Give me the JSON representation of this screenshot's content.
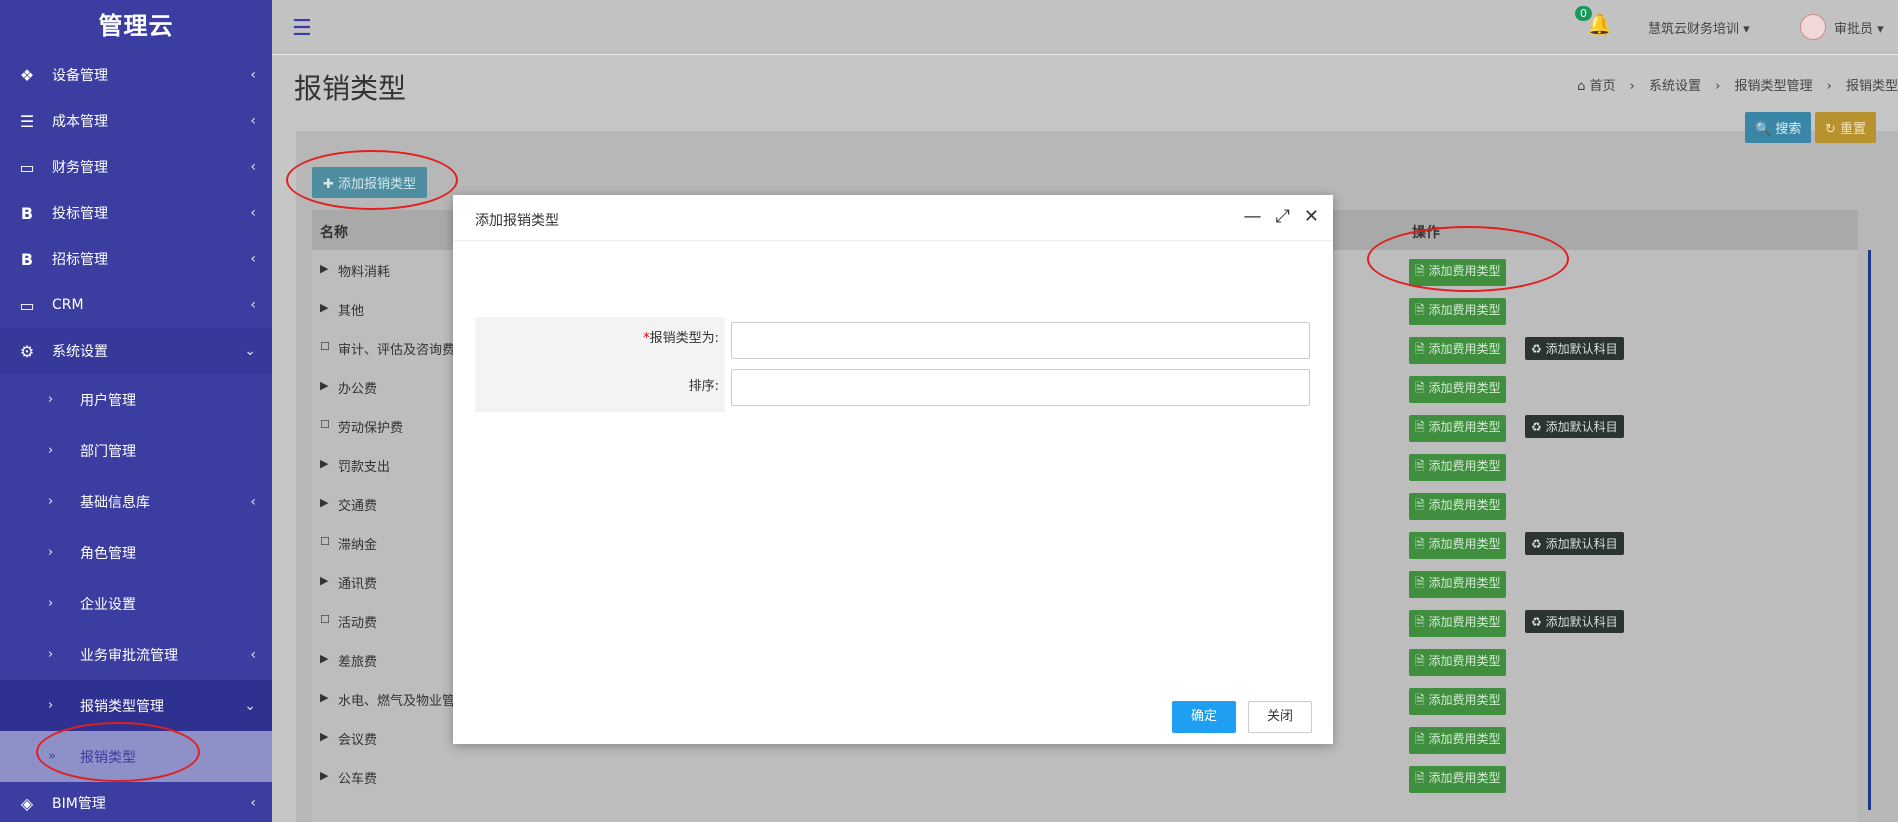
{
  "app": {
    "brand": "管理云"
  },
  "sidebar": {
    "items": [
      {
        "label": "设备管理",
        "icon": "cubes-icon",
        "glyph": "❖"
      },
      {
        "label": "成本管理",
        "icon": "list-icon",
        "glyph": "☰"
      },
      {
        "label": "财务管理",
        "icon": "desktop-icon",
        "glyph": "▭"
      },
      {
        "label": "投标管理",
        "icon": "bold-b-icon",
        "glyph": "B"
      },
      {
        "label": "招标管理",
        "icon": "bold-b-icon",
        "glyph": "B"
      },
      {
        "label": "CRM",
        "icon": "desktop-icon",
        "glyph": "▭"
      },
      {
        "label": "系统设置",
        "icon": "gear-icon",
        "glyph": "⚙"
      }
    ],
    "sub_items": [
      {
        "label": "用户管理"
      },
      {
        "label": "部门管理"
      },
      {
        "label": "基础信息库"
      },
      {
        "label": "角色管理"
      },
      {
        "label": "企业设置"
      },
      {
        "label": "业务审批流管理"
      },
      {
        "label": "报销类型管理"
      },
      {
        "label": "报销类型"
      }
    ],
    "bottom": {
      "label": "BIM管理",
      "icon": "cube-icon",
      "glyph": "◈"
    }
  },
  "topbar": {
    "notifications": "0",
    "org": "慧筑云财务培训 ▾",
    "user": "审批员 ▾"
  },
  "page": {
    "title": "报销类型",
    "breadcrumb": [
      "首页",
      "系统设置",
      "报销类型管理",
      "报销类型"
    ]
  },
  "toolbar": {
    "add": "✚ 添加报销类型",
    "search": "🔍 搜索",
    "reset": "↻ 重置"
  },
  "table": {
    "headers": {
      "name": "名称",
      "op": "操作"
    },
    "rows": [
      {
        "toggle": "▶",
        "name": "物料消耗",
        "default": ""
      },
      {
        "toggle": "▶",
        "name": "其他",
        "default": ""
      },
      {
        "toggle": "☐",
        "name": "审计、评估及咨询费",
        "default": "♻ 添加默认科目"
      },
      {
        "toggle": "▶",
        "name": "办公费",
        "default": ""
      },
      {
        "toggle": "☐",
        "name": "劳动保护费",
        "default": "♻ 添加默认科目"
      },
      {
        "toggle": "▶",
        "name": "罚款支出",
        "default": ""
      },
      {
        "toggle": "▶",
        "name": "交通费",
        "default": ""
      },
      {
        "toggle": "☐",
        "name": "滞纳金",
        "default": "♻ 添加默认科目"
      },
      {
        "toggle": "▶",
        "name": "通讯费",
        "default": ""
      },
      {
        "toggle": "☐",
        "name": "活动费",
        "default": "♻ 添加默认科目"
      },
      {
        "toggle": "▶",
        "name": "差旅费",
        "default": ""
      },
      {
        "toggle": "▶",
        "name": "水电、燃气及物业管",
        "default": ""
      },
      {
        "toggle": "▶",
        "name": "会议费",
        "default": ""
      },
      {
        "toggle": "▶",
        "name": "公车费",
        "default": ""
      }
    ],
    "add_fee_label": "🗎 添加费用类型"
  },
  "modal": {
    "title": "添加报销类型",
    "field_type_label": "报销类型为:",
    "field_type_required": "*",
    "field_type_value": "",
    "field_order_label": "排序:",
    "field_order_value": "",
    "ok": "确定",
    "close": "关闭"
  }
}
